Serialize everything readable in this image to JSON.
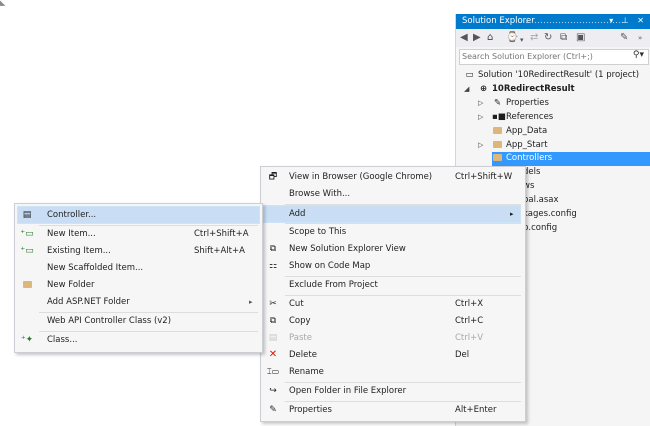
{
  "solution_explorer": {
    "title": "Solution Explorer",
    "title_buttons": "▾ ⊥ ✕",
    "search_placeholder": "Search Solution Explorer (Ctrl+;)",
    "tree": [
      {
        "label": "Solution '10RedirectResult' (1 project)",
        "icon": "solution-icon"
      },
      {
        "label": "10RedirectResult",
        "icon": "web-project-icon",
        "bold": true
      },
      {
        "label": "Properties",
        "icon": "wrench-icon"
      },
      {
        "label": "References",
        "icon": "references-icon"
      },
      {
        "label": "App_Data",
        "icon": "folder-icon"
      },
      {
        "label": "App_Start",
        "icon": "folder-icon"
      },
      {
        "label": "Controllers",
        "icon": "folder-icon",
        "selected": true
      },
      {
        "label": "dels"
      },
      {
        "label": "ws"
      },
      {
        "label": "bal.asax"
      },
      {
        "label": "kages.config"
      },
      {
        "label": "b.config"
      }
    ]
  },
  "context_menu": {
    "items": [
      {
        "label": "View in Browser (Google Chrome)",
        "shortcut": "Ctrl+Shift+W",
        "icon": "browser-icon"
      },
      {
        "label": "Browse With..."
      },
      {
        "label": "Add",
        "highlighted": true
      },
      {
        "label": "Scope to This"
      },
      {
        "label": "New Solution Explorer View",
        "icon": "new-view-icon"
      },
      {
        "label": "Show on Code Map",
        "icon": "code-map-icon"
      },
      {
        "label": "Exclude From Project"
      },
      {
        "label": "Cut",
        "shortcut": "Ctrl+X",
        "icon": "cut-icon"
      },
      {
        "label": "Copy",
        "shortcut": "Ctrl+C",
        "icon": "copy-icon"
      },
      {
        "label": "Paste",
        "shortcut": "Ctrl+V",
        "icon": "paste-icon",
        "disabled": true
      },
      {
        "label": "Delete",
        "shortcut": "Del",
        "icon": "delete-icon"
      },
      {
        "label": "Rename",
        "icon": "rename-icon"
      },
      {
        "label": "Open Folder in File Explorer",
        "icon": "open-folder-icon"
      },
      {
        "label": "Properties",
        "shortcut": "Alt+Enter",
        "icon": "wrench-icon"
      }
    ]
  },
  "add_submenu": {
    "items": [
      {
        "label": "Controller...",
        "icon": "controller-icon",
        "highlighted": true
      },
      {
        "label": "New Item...",
        "shortcut": "Ctrl+Shift+A",
        "icon": "new-item-icon"
      },
      {
        "label": "Existing Item...",
        "shortcut": "Shift+Alt+A",
        "icon": "existing-item-icon"
      },
      {
        "label": "New Scaffolded Item..."
      },
      {
        "label": "New Folder",
        "icon": "new-folder-icon"
      },
      {
        "label": "Add ASP.NET Folder"
      },
      {
        "label": "Web API Controller Class (v2)"
      },
      {
        "label": "Class...",
        "icon": "class-icon"
      }
    ]
  },
  "colors": {
    "accent": "#007acc",
    "selection": "#3399ff",
    "menu_highlight": "#c9def5",
    "delete_red": "#e51400"
  }
}
